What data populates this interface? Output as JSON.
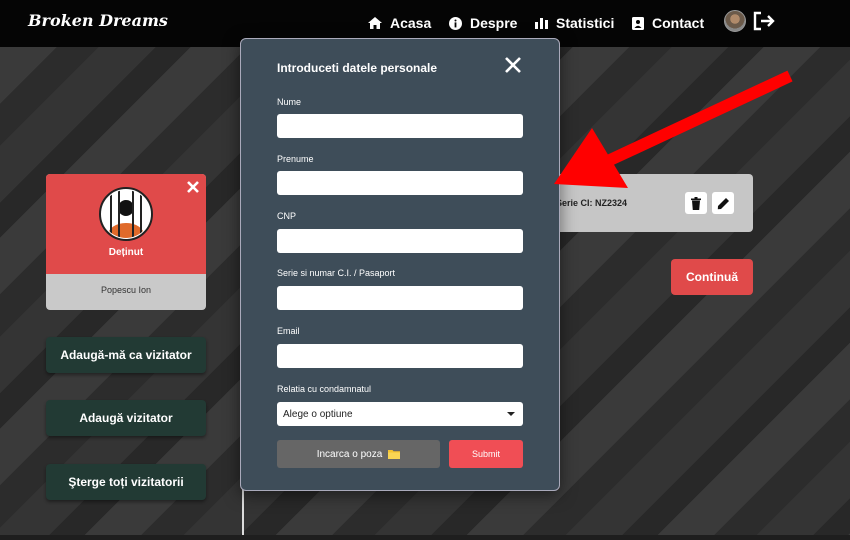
{
  "brand": "Broken Dreams",
  "nav": [
    {
      "label": "Acasa",
      "icon": "home-icon"
    },
    {
      "label": "Despre",
      "icon": "info-icon"
    },
    {
      "label": "Statistici",
      "icon": "chart-icon"
    },
    {
      "label": "Contact",
      "icon": "contact-icon"
    }
  ],
  "prisoner": {
    "role": "Deținut",
    "name": "Popescu Ion"
  },
  "side_buttons": {
    "add_me": "Adaugă-mă ca vizitator",
    "add_visitor": "Adaugă vizitator",
    "delete_all": "Şterge toți vizitatorii"
  },
  "visitor": {
    "text": "Serie CI: NZ2324"
  },
  "continue_label": "Continuă",
  "modal": {
    "title": "Introduceti datele personale",
    "fields": {
      "nume": {
        "label": "Nume",
        "value": ""
      },
      "prenume": {
        "label": "Prenume",
        "value": ""
      },
      "cnp": {
        "label": "CNP",
        "value": ""
      },
      "serie": {
        "label": "Serie si numar C.I. / Pasaport",
        "value": ""
      },
      "email": {
        "label": "Email",
        "value": ""
      }
    },
    "relation": {
      "label": "Relatia cu condamnatul",
      "selected": "Alege o optiune"
    },
    "upload_label": "Incarca o poza",
    "submit_label": "Submit"
  },
  "colors": {
    "navbar": "#050505",
    "accent_red": "#e04a4a",
    "modal_bg": "#3e4d59",
    "side_button": "#223a34"
  }
}
